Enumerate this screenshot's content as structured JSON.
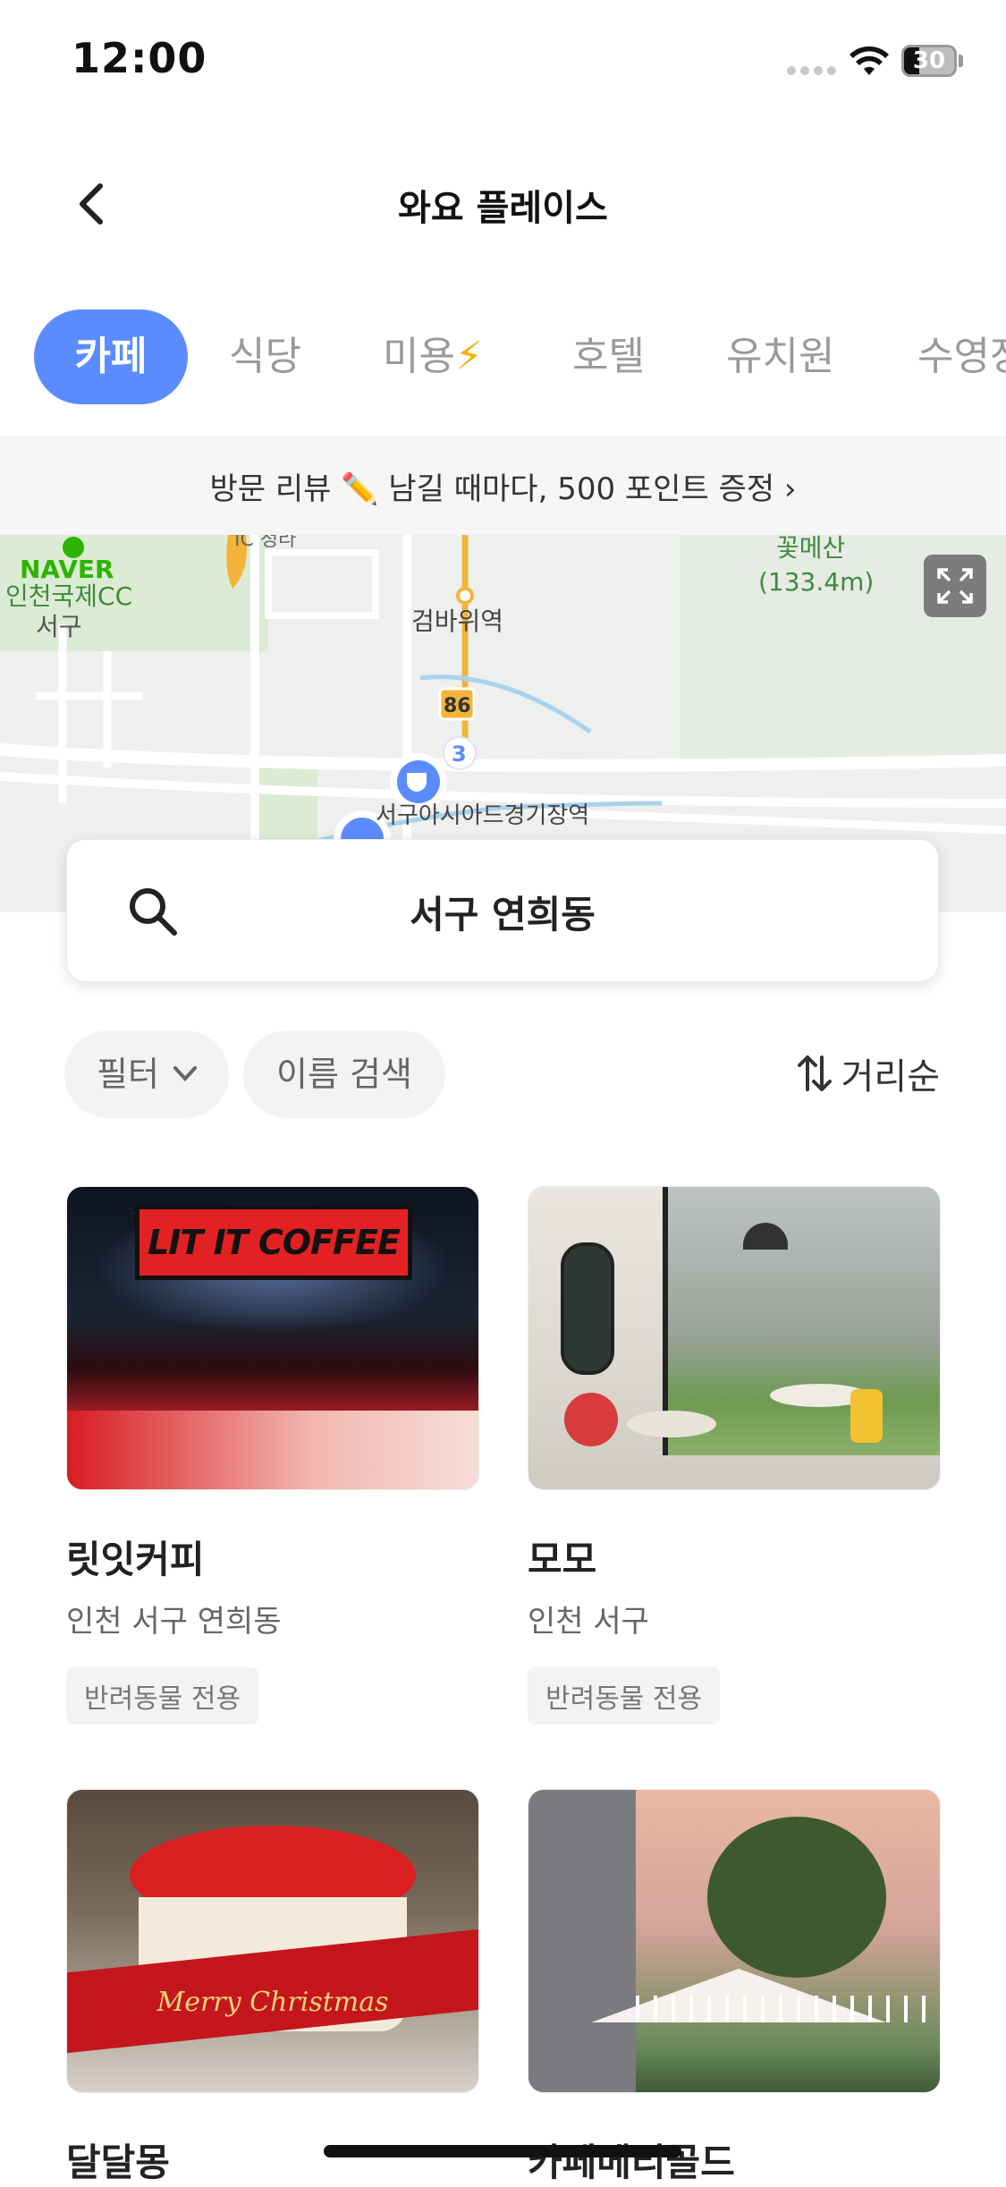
{
  "status": {
    "time": "12:00",
    "battery": "30"
  },
  "nav": {
    "title": "와요 플레이스"
  },
  "tabs": [
    {
      "label": "카페",
      "active": true
    },
    {
      "label": "식당"
    },
    {
      "label": "미용"
    },
    {
      "label": "호텔"
    },
    {
      "label": "유치원"
    },
    {
      "label": "수영장"
    }
  ],
  "banner": {
    "text": "방문 리뷰 ✏️ 남길 때마다, 500 포인트 증정 ›"
  },
  "map": {
    "brand": "NAVER",
    "labels": {
      "cc": "인천국제CC",
      "seogu": "서구",
      "ic": "IC 청라",
      "geombawi": "검바위역",
      "route": "86",
      "mountain": "꽃메산",
      "mountain_height": "(133.4m)",
      "stadium": "서구아시아드경기장역",
      "cluster": "3"
    }
  },
  "search": {
    "location": "서구 연희동"
  },
  "filters": {
    "filter_label": "필터",
    "name_search_label": "이름 검색",
    "sort_label": "거리순"
  },
  "places": [
    {
      "name": "릿잇커피",
      "location": "인천 서구 연희동",
      "badge": "반려동물 전용",
      "sign_text": "LIT IT COFFEE"
    },
    {
      "name": "모모",
      "location": "인천 서구",
      "badge": "반려동물 전용"
    },
    {
      "name": "달달몽",
      "cake_text": "Merry Christmas"
    },
    {
      "name": "카페메리골드"
    }
  ],
  "colors": {
    "accent": "#5b8cff",
    "bolt": "#f6b400"
  }
}
